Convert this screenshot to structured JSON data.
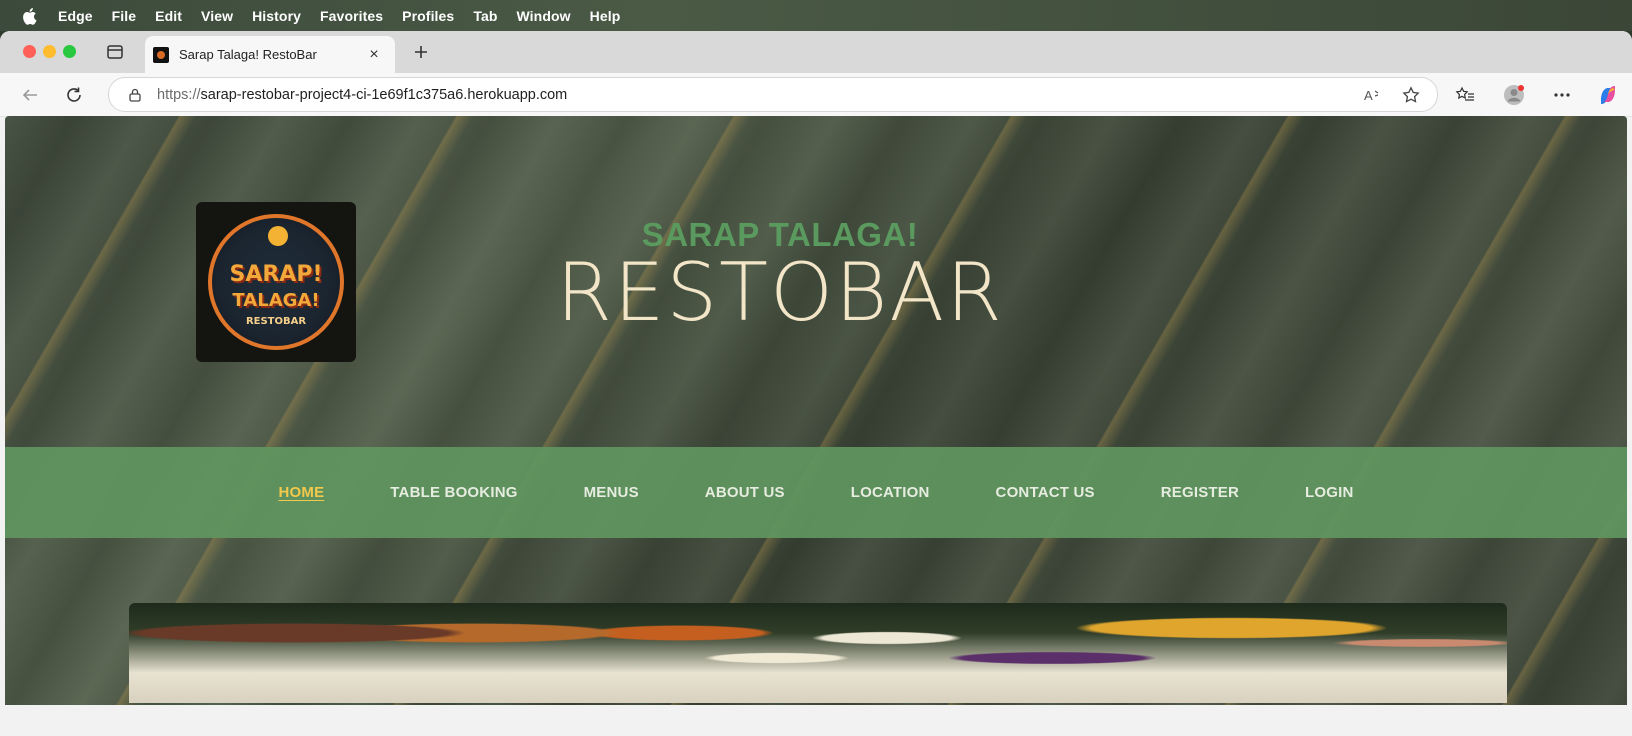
{
  "menubar": {
    "apple_icon": "apple-logo",
    "app_name": "Edge",
    "items": [
      "File",
      "Edit",
      "View",
      "History",
      "Favorites",
      "Profiles",
      "Tab",
      "Window",
      "Help"
    ]
  },
  "browser": {
    "tab": {
      "title": "Sarap Talaga! RestoBar",
      "favicon": "restobar-favicon",
      "close_label": "×"
    },
    "new_tab_icon": "plus-icon",
    "address_bar": {
      "protocol": "https://",
      "host": "sarap-restobar-project4-ci-1e69f1c375a6.herokuapp.com"
    }
  },
  "page": {
    "logo": {
      "line1": "SARAP!",
      "line2": "TALAGA!",
      "line3": "RESTOBAR"
    },
    "brand": {
      "subtitle": "SARAP TALAGA!",
      "title": "RESTOBAR"
    },
    "nav": {
      "items": [
        "HOME",
        "TABLE BOOKING",
        "MENUS",
        "ABOUT US",
        "LOCATION",
        "CONTACT US",
        "REGISTER",
        "LOGIN"
      ],
      "active": "HOME"
    },
    "colors": {
      "nav_bg": "#5f9660",
      "nav_active": "#f2c94c",
      "brand_subtitle": "#5a9a5e",
      "brand_title": "#f3e6c8"
    }
  }
}
